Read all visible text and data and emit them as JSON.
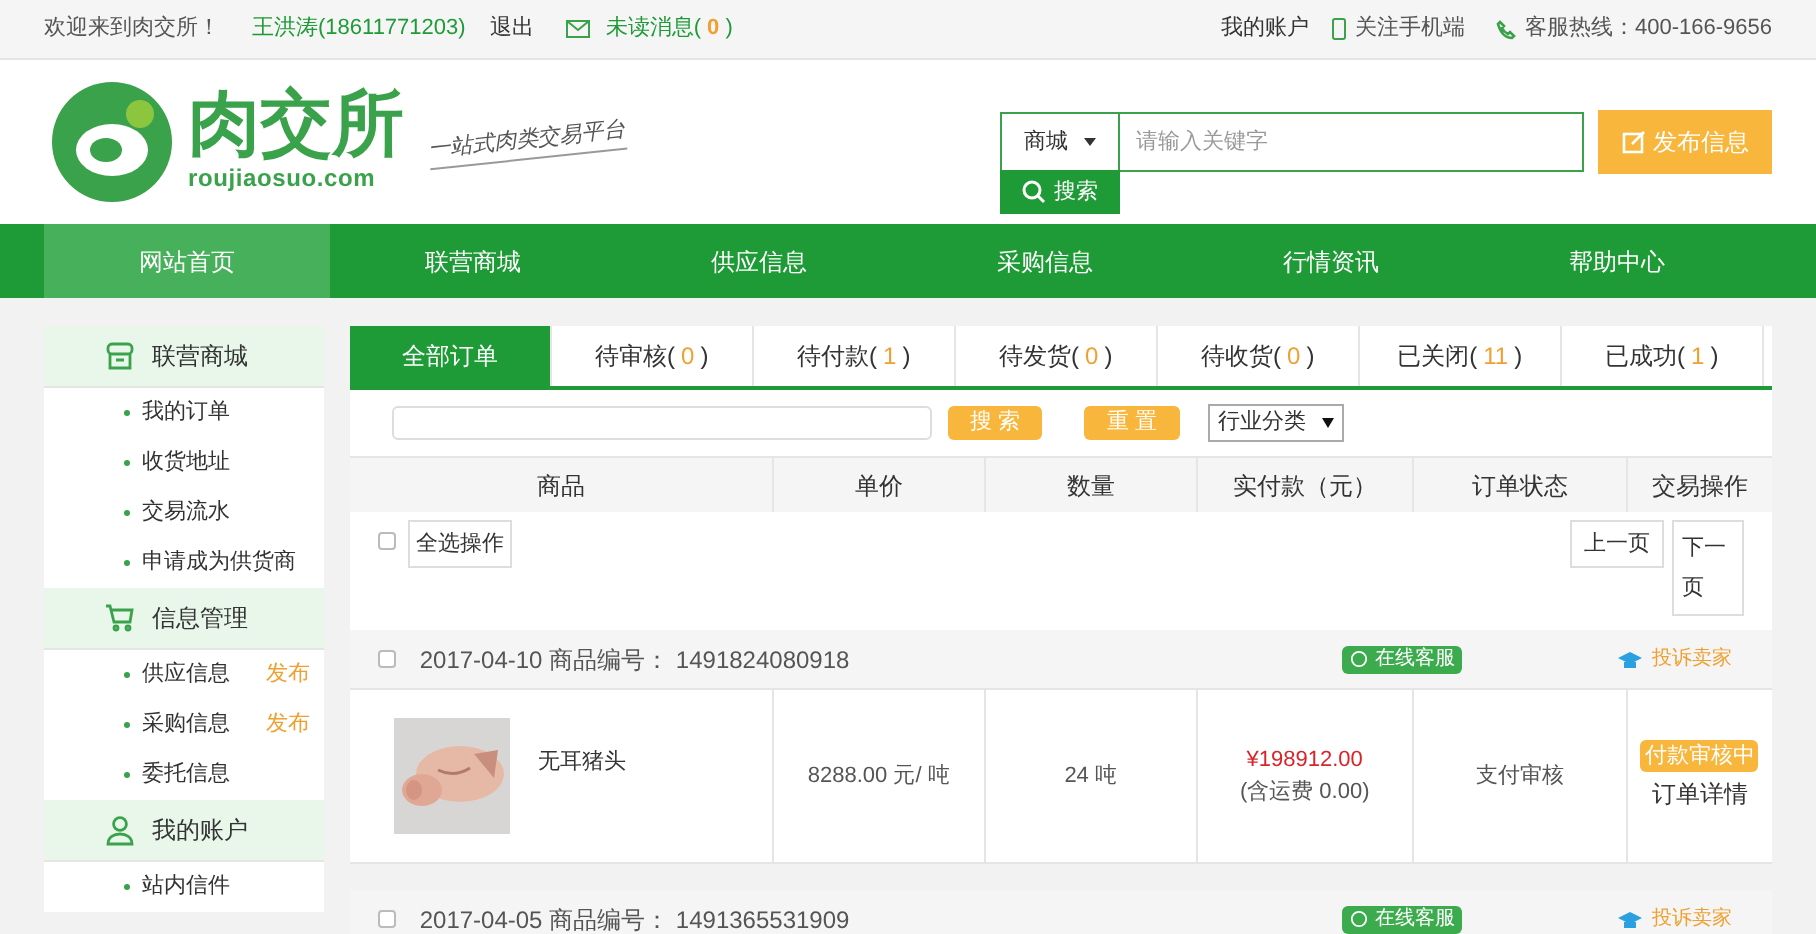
{
  "topbar": {
    "welcome": "欢迎来到肉交所！",
    "user": "王洪涛(18611771203)",
    "logout": "退出",
    "messages_label": "未读消息(",
    "messages_count": "0",
    "messages_close": ")",
    "account": "我的账户",
    "mobile": "关注手机端",
    "hotline": "客服热线：400-166-9656"
  },
  "header": {
    "logo_name": "肉交所",
    "logo_domain": "roujiaosuo.com",
    "slogan": "一站式肉类交易平台",
    "search_scope": "商城",
    "search_placeholder": "请输入关键字",
    "search_button": "搜索",
    "publish_button": "发布信息"
  },
  "nav": [
    {
      "label": "网站首页",
      "selected": true
    },
    {
      "label": "联营商城",
      "selected": false
    },
    {
      "label": "供应信息",
      "selected": false
    },
    {
      "label": "采购信息",
      "selected": false
    },
    {
      "label": "行情资讯",
      "selected": false
    },
    {
      "label": "帮助中心",
      "selected": false
    }
  ],
  "sidebar": [
    {
      "title": "联营商城",
      "kind": "shop",
      "items": [
        {
          "label": "我的订单"
        },
        {
          "label": "收货地址"
        },
        {
          "label": "交易流水"
        },
        {
          "label": "申请成为供货商"
        }
      ]
    },
    {
      "title": "信息管理",
      "kind": "cart",
      "items": [
        {
          "label": "供应信息",
          "action": "发布"
        },
        {
          "label": "采购信息",
          "action": "发布"
        },
        {
          "label": "委托信息"
        }
      ]
    },
    {
      "title": "我的账户",
      "kind": "user",
      "items": [
        {
          "label": "站内信件"
        }
      ]
    }
  ],
  "tabs": [
    {
      "label": "全部订单",
      "selected": true
    },
    {
      "label": "待审核",
      "open": "(",
      "count": "0",
      "close": ")",
      "selected": false
    },
    {
      "label": "待付款",
      "open": "(",
      "count": "1",
      "close": ")",
      "selected": false
    },
    {
      "label": "待发货",
      "open": "(",
      "count": "0",
      "close": ")",
      "selected": false
    },
    {
      "label": "待收货",
      "open": "(",
      "count": "0",
      "close": ")",
      "selected": false
    },
    {
      "label": "已关闭",
      "open": "(",
      "count": "11",
      "close": ")",
      "selected": false
    },
    {
      "label": "已成功",
      "open": "(",
      "count": "1",
      "close": ")",
      "selected": false
    }
  ],
  "filter": {
    "search_button": "搜 索",
    "reset_button": "重 置",
    "category": "行业分类"
  },
  "table": {
    "columns": [
      "商品",
      "单价",
      "数量",
      "实付款（元）",
      "订单状态",
      "交易操作"
    ],
    "select_all": "全选操作",
    "select_all_checked": false,
    "prev_page": "上一页",
    "next_page": "下一页",
    "orders": [
      {
        "date": "2017-04-10",
        "number_label": "商品编号：",
        "number": "1491824080918",
        "service": "在线客服",
        "complain": "投诉卖家",
        "checked": false,
        "item": {
          "kind": "picture",
          "name": "无耳猪头",
          "price": "8288.00 元/ 吨",
          "quantity": "24 吨",
          "paid": "¥198912.00",
          "shipping": "(含运费 0.00)",
          "status": "支付审核",
          "action": "付款审核中",
          "detail": "订单详情"
        }
      },
      {
        "date": "2017-04-05",
        "number_label": "商品编号：",
        "number": "1491365531909",
        "service": "在线客服",
        "complain": "投诉卖家",
        "checked": false
      }
    ]
  }
}
